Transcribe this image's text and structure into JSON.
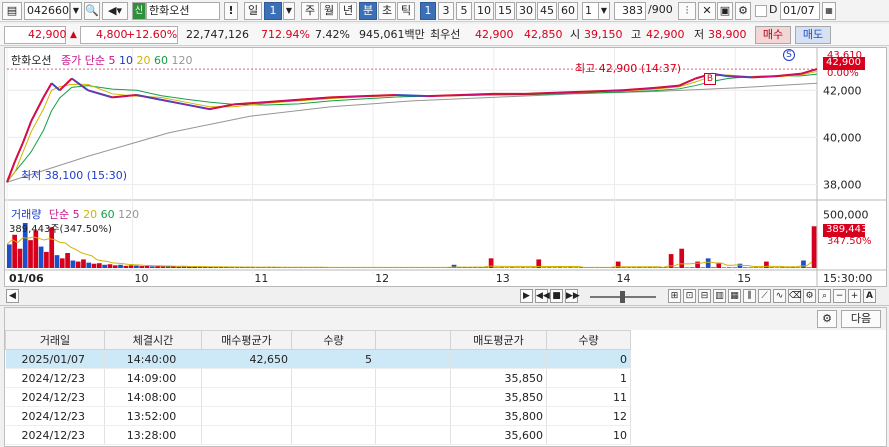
{
  "toolbar": {
    "code": "042660",
    "stock_name": "한화오션",
    "sin_badge": "신",
    "period_buttons": [
      "일",
      "1",
      "주",
      "월",
      "년",
      "분",
      "초",
      "틱"
    ],
    "interval_buttons": [
      "1",
      "3",
      "5",
      "10",
      "15",
      "30",
      "45",
      "60"
    ],
    "multiplier": "1",
    "page_count": "383",
    "page_total": "/900",
    "date_check_label": "D",
    "date_value": "01/07"
  },
  "quote": {
    "price": "42,900",
    "change": "4,800",
    "change_pct": "+12.60%",
    "volume": "22,747,126",
    "volume_ratio": "712.94%",
    "turnover": "7.42%",
    "amount": "945,061백만",
    "best_label": "최우선",
    "best_ask": "42,900",
    "best_bid": "42,850",
    "open_label": "시",
    "open": "39,150",
    "high_label": "고",
    "high": "42,900",
    "low_label": "저",
    "low": "38,900",
    "buy_label": "매수",
    "sell_label": "매도"
  },
  "chart_data": {
    "type": "line",
    "price_panel": {
      "title": "한화오션",
      "indicator_label": "종가 단순",
      "ma_periods": [
        "5",
        "10",
        "20",
        "60",
        "120"
      ],
      "ma_colors": [
        "#c8148c",
        "#1e3cc8",
        "#d2b400",
        "#14a046",
        "#969696"
      ],
      "y_ticks": [
        42000,
        40000,
        38000
      ],
      "ylim": [
        37600,
        43200
      ],
      "current_price_label": "42,900",
      "current_pct_label": "0.00%",
      "top_price_label": "43,610",
      "high_annotation": "최고 42,900 (14:37)",
      "low_annotation": "최저 38,100 (15:30)",
      "marker_s": "S",
      "marker_b": "B",
      "close_series": [
        {
          "t": 0.0,
          "v": 38100
        },
        {
          "t": 0.01,
          "v": 39000
        },
        {
          "t": 0.02,
          "v": 39800
        },
        {
          "t": 0.03,
          "v": 40700
        },
        {
          "t": 0.045,
          "v": 41700
        },
        {
          "t": 0.055,
          "v": 42300
        },
        {
          "t": 0.065,
          "v": 42000
        },
        {
          "t": 0.08,
          "v": 42500
        },
        {
          "t": 0.1,
          "v": 42000
        },
        {
          "t": 0.13,
          "v": 41700
        },
        {
          "t": 0.16,
          "v": 41800
        },
        {
          "t": 0.19,
          "v": 41600
        },
        {
          "t": 0.22,
          "v": 41400
        },
        {
          "t": 0.25,
          "v": 41200
        },
        {
          "t": 0.28,
          "v": 41400
        },
        {
          "t": 0.32,
          "v": 41500
        },
        {
          "t": 0.36,
          "v": 41600
        },
        {
          "t": 0.4,
          "v": 41700
        },
        {
          "t": 0.44,
          "v": 41750
        },
        {
          "t": 0.48,
          "v": 41800
        },
        {
          "t": 0.52,
          "v": 41750
        },
        {
          "t": 0.56,
          "v": 41800
        },
        {
          "t": 0.6,
          "v": 41850
        },
        {
          "t": 0.64,
          "v": 41850
        },
        {
          "t": 0.68,
          "v": 41900
        },
        {
          "t": 0.72,
          "v": 41950
        },
        {
          "t": 0.76,
          "v": 42000
        },
        {
          "t": 0.8,
          "v": 42100
        },
        {
          "t": 0.83,
          "v": 42200
        },
        {
          "t": 0.85,
          "v": 42500
        },
        {
          "t": 0.87,
          "v": 42700
        },
        {
          "t": 0.89,
          "v": 42600
        },
        {
          "t": 0.92,
          "v": 42550
        },
        {
          "t": 0.95,
          "v": 42600
        },
        {
          "t": 0.98,
          "v": 42700
        },
        {
          "t": 1.0,
          "v": 42900
        }
      ],
      "ma120_series": [
        {
          "t": 0.0,
          "v": 38100
        },
        {
          "t": 0.1,
          "v": 39200
        },
        {
          "t": 0.2,
          "v": 40200
        },
        {
          "t": 0.3,
          "v": 40900
        },
        {
          "t": 0.4,
          "v": 41300
        },
        {
          "t": 0.5,
          "v": 41550
        },
        {
          "t": 0.6,
          "v": 41700
        },
        {
          "t": 0.7,
          "v": 41850
        },
        {
          "t": 0.8,
          "v": 41950
        },
        {
          "t": 0.9,
          "v": 42100
        },
        {
          "t": 1.0,
          "v": 42300
        }
      ]
    },
    "volume_panel": {
      "title": "거래량",
      "indicator_label": "단순",
      "ma_periods": [
        "5",
        "20",
        "60",
        "120"
      ],
      "y_ticks": [
        500000
      ],
      "ylim": [
        0,
        560000
      ],
      "current_label": "389,443",
      "current_pct_label": "347.50%",
      "left_readout": "389,443주(347.50%)",
      "bars": [
        220000,
        310000,
        180000,
        420000,
        260000,
        350000,
        200000,
        150000,
        380000,
        120000,
        90000,
        140000,
        70000,
        60000,
        80000,
        50000,
        40000,
        45000,
        30000,
        35000,
        25000,
        30000,
        20000,
        25000,
        22000,
        18000,
        20000,
        15000,
        18000,
        16000,
        14000,
        15000,
        12000,
        14000,
        12000,
        10000,
        12000,
        11000,
        10000,
        9000,
        10000,
        9000,
        8000,
        9000,
        8000,
        9000,
        8000,
        7000,
        8000,
        7000,
        8000,
        7000,
        6000,
        7000,
        6000,
        7000,
        6000,
        7000,
        6000,
        7000,
        6000,
        5000,
        6000,
        5000,
        6000,
        5000,
        7000,
        6000,
        5000,
        6000,
        5000,
        6000,
        5000,
        6000,
        5000,
        6000,
        5000,
        6000,
        5000,
        6000,
        5000,
        6000,
        5000,
        6000,
        30000,
        5000,
        6000,
        5000,
        6000,
        5000,
        6000,
        90000,
        5000,
        6000,
        5000,
        6000,
        5000,
        6000,
        5000,
        6000,
        80000,
        5000,
        6000,
        5000,
        6000,
        5000,
        6000,
        5000,
        6000,
        5000,
        6000,
        5000,
        6000,
        5000,
        6000,
        60000,
        5000,
        6000,
        5000,
        6000,
        5000,
        6000,
        5000,
        6000,
        5000,
        130000,
        6000,
        180000,
        5000,
        6000,
        60000,
        5000,
        90000,
        6000,
        50000,
        5000,
        6000,
        5000,
        40000,
        6000,
        5000,
        6000,
        5000,
        60000,
        6000,
        5000,
        6000,
        5000,
        6000,
        5000,
        70000,
        6000,
        389443
      ]
    },
    "x_labels": [
      {
        "label": "01/06",
        "t": 0.0
      },
      {
        "label": "10",
        "t": 0.155
      },
      {
        "label": "11",
        "t": 0.303
      },
      {
        "label": "12",
        "t": 0.452
      },
      {
        "label": "13",
        "t": 0.601
      },
      {
        "label": "14",
        "t": 0.75
      },
      {
        "label": "15",
        "t": 0.899
      }
    ],
    "time_label": "15:30:00"
  },
  "table": {
    "next_button": "다음",
    "columns": [
      "거래일",
      "체결시간",
      "매수평균가",
      "수량",
      "",
      "매도평균가",
      "수량"
    ],
    "rows": [
      [
        "2025/01/07",
        "14:40:00",
        "42,650",
        "5",
        "",
        "",
        "0"
      ],
      [
        "2024/12/23",
        "14:09:00",
        "",
        "",
        "",
        "35,850",
        "1"
      ],
      [
        "2024/12/23",
        "14:08:00",
        "",
        "",
        "",
        "35,850",
        "11"
      ],
      [
        "2024/12/23",
        "13:52:00",
        "",
        "",
        "",
        "35,800",
        "12"
      ],
      [
        "2024/12/23",
        "13:28:00",
        "",
        "",
        "",
        "35,600",
        "10"
      ]
    ]
  }
}
